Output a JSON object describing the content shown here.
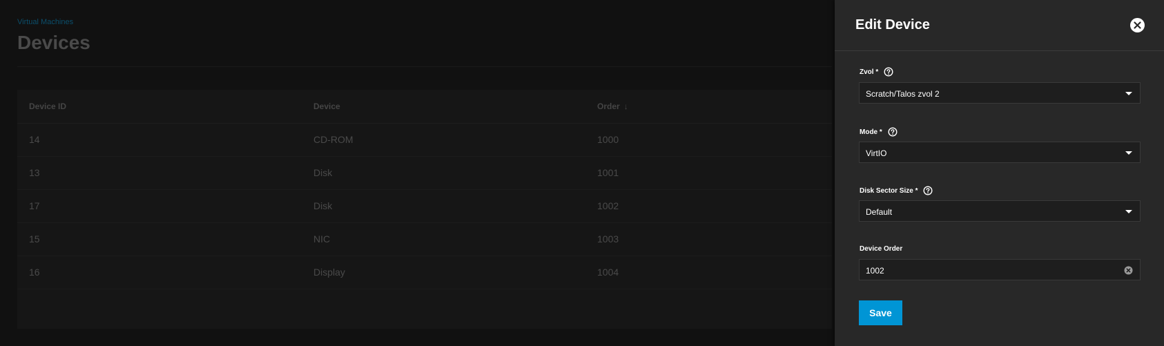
{
  "page": {
    "breadcrumb": "Virtual Machines",
    "title": "Devices",
    "table": {
      "columns": [
        "Device ID",
        "Device",
        "Order"
      ],
      "sort_icon": "arrow-down-icon",
      "rows": [
        {
          "id": "14",
          "device": "CD-ROM",
          "order": "1000"
        },
        {
          "id": "13",
          "device": "Disk",
          "order": "1001"
        },
        {
          "id": "17",
          "device": "Disk",
          "order": "1002"
        },
        {
          "id": "15",
          "device": "NIC",
          "order": "1003"
        },
        {
          "id": "16",
          "device": "Display",
          "order": "1004"
        }
      ]
    }
  },
  "drawer": {
    "title": "Edit Device",
    "close_icon": "close-icon",
    "fields": {
      "zvol": {
        "label": "Zvol *",
        "value": "Scratch/Talos zvol 2"
      },
      "mode": {
        "label": "Mode *",
        "value": "VirtIO"
      },
      "sector_size": {
        "label": "Disk Sector Size *",
        "value": "Default"
      },
      "device_order": {
        "label": "Device Order",
        "value": "1002"
      }
    },
    "save_label": "Save"
  },
  "colors": {
    "accent": "#0095d5",
    "drawer_bg": "#282828",
    "page_bg": "#111111"
  }
}
